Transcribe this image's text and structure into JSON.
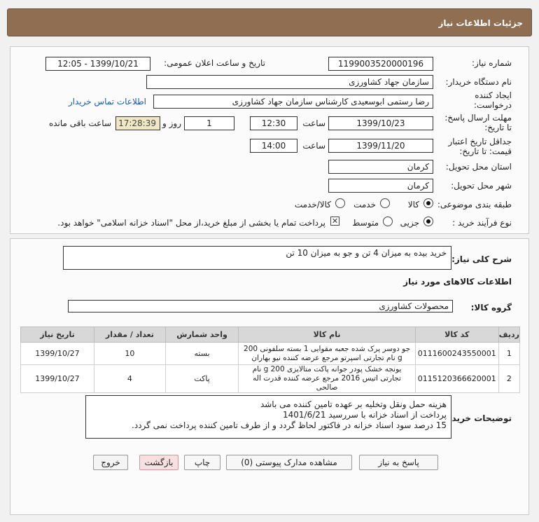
{
  "header": {
    "title": "جزئیات اطلاعات نیاز"
  },
  "form": {
    "need_number_label": "شماره نیاز:",
    "need_number": "1199003520000196",
    "announce_label": "تاریخ و ساعت اعلان عمومی:",
    "announce_value": "1399/10/21 - 12:05",
    "buyer_org_label": "نام دستگاه خریدار:",
    "buyer_org": "سازمان جهاد کشاورزی",
    "requester_label": "ایجاد کننده درخواست:",
    "requester": "رضا رستمی ابوسعیدی کارشناس سازمان جهاد کشاورزی",
    "contact_link": "اطلاعات تماس خریدار",
    "deadline_label": "مهلت ارسال پاسخ: تا تاریخ:",
    "deadline_date": "1399/10/23",
    "hour_label": "ساعت",
    "deadline_time": "12:30",
    "days_value": "1",
    "day_label": "روز و",
    "remaining_time": "17:28:39",
    "remaining_label": "ساعت باقی مانده",
    "validity_label": "جداقل تاریخ اعتبار قیمت: تا تاریخ:",
    "validity_date": "1399/11/20",
    "validity_time": "14:00",
    "province_label": "استان محل تحویل:",
    "province": "کرمان",
    "city_label": "شهر محل تحویل:",
    "city": "کرمان",
    "category_label": "طبقه بندی موضوعی:",
    "category_options": [
      "کالا",
      "خدمت",
      "کالا/خدمت"
    ],
    "process_label": "نوع فرآیند خرید :",
    "process_options": [
      "جزیی",
      "متوسط"
    ],
    "payment_note": "پرداخت تمام یا بخشی از مبلغ خرید،از محل \"اسناد خزانه اسلامی\" خواهد بود."
  },
  "details": {
    "summary_label": "شرح کلی نیاز:",
    "summary": "خرید بیده به میزان 4 تن و جو به میزان 10 تن",
    "goods_info_label": "اطلاعات کالاهای مورد نیاز",
    "group_label": "گروه کالا:",
    "group": "محصولات کشاورزی",
    "table": {
      "headers": [
        "ردیف",
        "کد کالا",
        "نام کالا",
        "واحد شمارش",
        "تعداد / مقدار",
        "تاریخ نیاز"
      ],
      "rows": [
        {
          "row": "1",
          "code": "0111600243550001",
          "name": "جو دوسر پرک شده جعبه مقوایی 1 بسته سلفونی 200 g نام تجارتی اسپرتو مرجع عرضه کننده نیو بهاران",
          "unit": "بسته",
          "qty": "10",
          "date": "1399/10/27"
        },
        {
          "row": "2",
          "code": "0115120366620001",
          "name": "یونجه خشک پودر جوانه پاکت متالایزی 200 g نام تجارتی اتیس 2016 مرجع عرضه کننده قدرت اله صالحی",
          "unit": "پاکت",
          "qty": "4",
          "date": "1399/10/27"
        }
      ]
    },
    "buyer_notes_label": "توضیحات خریدار:",
    "buyer_notes": [
      "هزینه حمل ونقل وتخلیه بر عهده تامین کننده می باشد",
      "پرداخت از اسناد خزانه با سررسید 1401/6/21",
      "15 درصد سود اسناد  خزانه در فاکتور لحاظ گردد و از طرف تامین کننده پرداخت نمی گردد."
    ]
  },
  "buttons": {
    "reply": "پاسخ به نیاز",
    "attachments": "مشاهده مدارک پیوستی (0)",
    "print": "چاپ",
    "back": "بازگشت",
    "exit": "خروج"
  },
  "watermark": {
    "brand": "ParsNamadData",
    "tagline": "مرکز فرآوری اطلاعات پارس نماد داده",
    "phone": "021-88349670",
    "digits": "1101 1001 0101"
  }
}
